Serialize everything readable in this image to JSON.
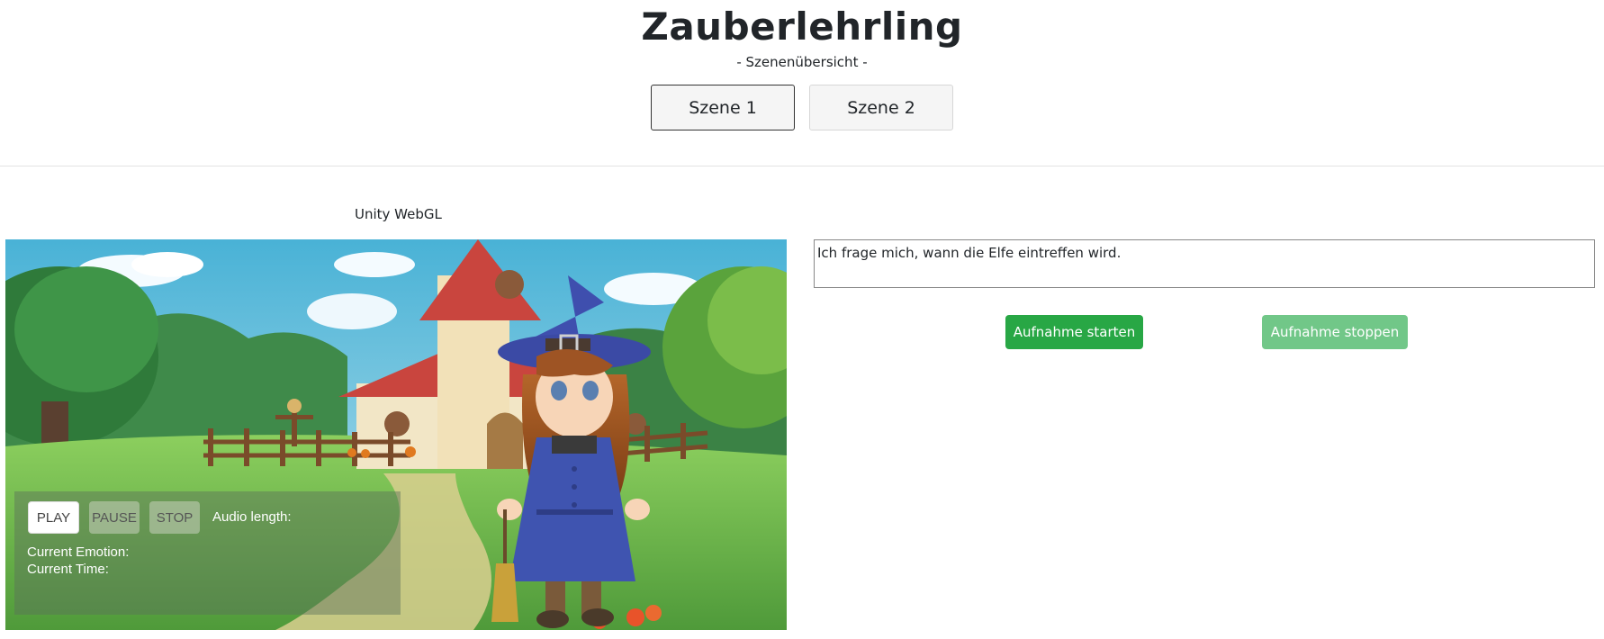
{
  "header": {
    "title": "Zauberlehrling",
    "subtitle": "- Szenenübersicht -",
    "scenes": [
      {
        "label": "Szene 1",
        "active": true
      },
      {
        "label": "Szene 2",
        "active": false
      }
    ]
  },
  "player": {
    "label": "Unity WebGL",
    "play_label": "PLAY",
    "pause_label": "PAUSE",
    "stop_label": "STOP",
    "audio_length_label": "Audio length:",
    "emotion_label": "Current Emotion:",
    "time_label": "Current Time:"
  },
  "recorder": {
    "transcript": "Ich frage mich, wann die Elfe eintreffen wird.",
    "start_label": "Aufnahme starten",
    "stop_label": "Aufnahme stoppen"
  },
  "colors": {
    "start_button": "#28a745",
    "stop_button": "#71c788"
  }
}
